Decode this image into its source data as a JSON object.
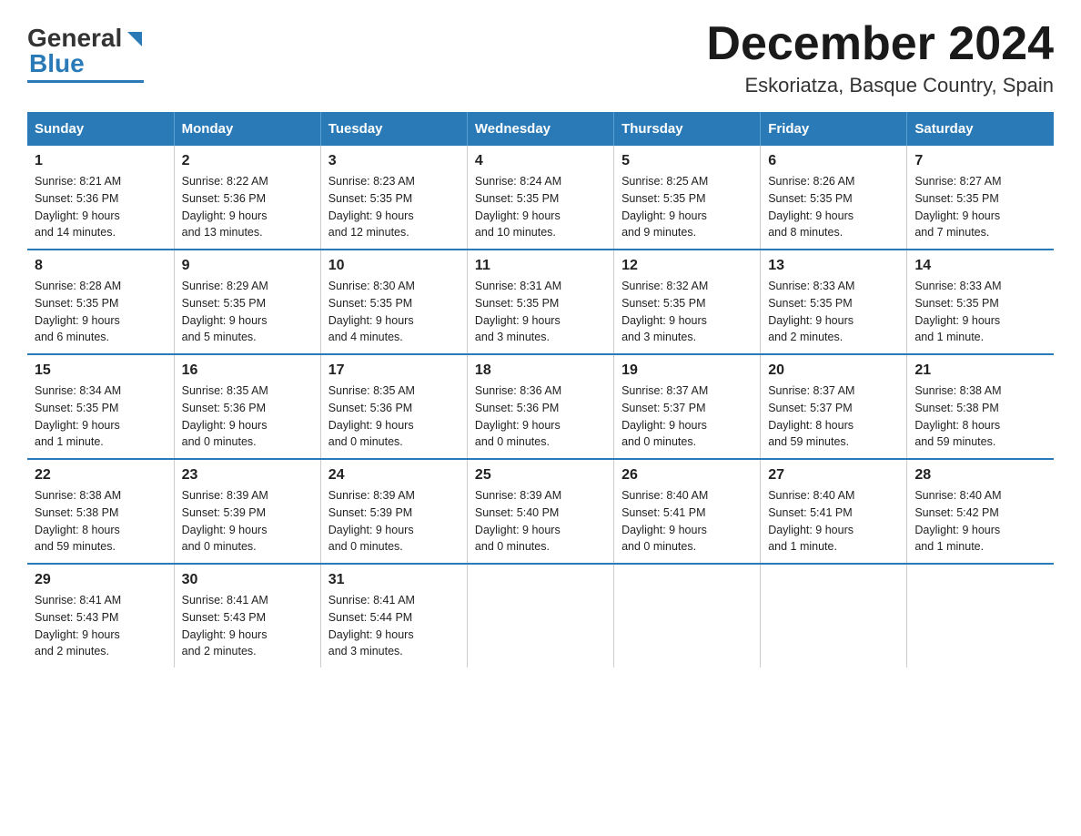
{
  "header": {
    "title": "December 2024",
    "subtitle": "Eskoriatza, Basque Country, Spain",
    "logo_general": "General",
    "logo_blue": "Blue"
  },
  "days_of_week": [
    "Sunday",
    "Monday",
    "Tuesday",
    "Wednesday",
    "Thursday",
    "Friday",
    "Saturday"
  ],
  "weeks": [
    [
      {
        "date": "1",
        "info": "Sunrise: 8:21 AM\nSunset: 5:36 PM\nDaylight: 9 hours\nand 14 minutes."
      },
      {
        "date": "2",
        "info": "Sunrise: 8:22 AM\nSunset: 5:36 PM\nDaylight: 9 hours\nand 13 minutes."
      },
      {
        "date": "3",
        "info": "Sunrise: 8:23 AM\nSunset: 5:35 PM\nDaylight: 9 hours\nand 12 minutes."
      },
      {
        "date": "4",
        "info": "Sunrise: 8:24 AM\nSunset: 5:35 PM\nDaylight: 9 hours\nand 10 minutes."
      },
      {
        "date": "5",
        "info": "Sunrise: 8:25 AM\nSunset: 5:35 PM\nDaylight: 9 hours\nand 9 minutes."
      },
      {
        "date": "6",
        "info": "Sunrise: 8:26 AM\nSunset: 5:35 PM\nDaylight: 9 hours\nand 8 minutes."
      },
      {
        "date": "7",
        "info": "Sunrise: 8:27 AM\nSunset: 5:35 PM\nDaylight: 9 hours\nand 7 minutes."
      }
    ],
    [
      {
        "date": "8",
        "info": "Sunrise: 8:28 AM\nSunset: 5:35 PM\nDaylight: 9 hours\nand 6 minutes."
      },
      {
        "date": "9",
        "info": "Sunrise: 8:29 AM\nSunset: 5:35 PM\nDaylight: 9 hours\nand 5 minutes."
      },
      {
        "date": "10",
        "info": "Sunrise: 8:30 AM\nSunset: 5:35 PM\nDaylight: 9 hours\nand 4 minutes."
      },
      {
        "date": "11",
        "info": "Sunrise: 8:31 AM\nSunset: 5:35 PM\nDaylight: 9 hours\nand 3 minutes."
      },
      {
        "date": "12",
        "info": "Sunrise: 8:32 AM\nSunset: 5:35 PM\nDaylight: 9 hours\nand 3 minutes."
      },
      {
        "date": "13",
        "info": "Sunrise: 8:33 AM\nSunset: 5:35 PM\nDaylight: 9 hours\nand 2 minutes."
      },
      {
        "date": "14",
        "info": "Sunrise: 8:33 AM\nSunset: 5:35 PM\nDaylight: 9 hours\nand 1 minute."
      }
    ],
    [
      {
        "date": "15",
        "info": "Sunrise: 8:34 AM\nSunset: 5:35 PM\nDaylight: 9 hours\nand 1 minute."
      },
      {
        "date": "16",
        "info": "Sunrise: 8:35 AM\nSunset: 5:36 PM\nDaylight: 9 hours\nand 0 minutes."
      },
      {
        "date": "17",
        "info": "Sunrise: 8:35 AM\nSunset: 5:36 PM\nDaylight: 9 hours\nand 0 minutes."
      },
      {
        "date": "18",
        "info": "Sunrise: 8:36 AM\nSunset: 5:36 PM\nDaylight: 9 hours\nand 0 minutes."
      },
      {
        "date": "19",
        "info": "Sunrise: 8:37 AM\nSunset: 5:37 PM\nDaylight: 9 hours\nand 0 minutes."
      },
      {
        "date": "20",
        "info": "Sunrise: 8:37 AM\nSunset: 5:37 PM\nDaylight: 8 hours\nand 59 minutes."
      },
      {
        "date": "21",
        "info": "Sunrise: 8:38 AM\nSunset: 5:38 PM\nDaylight: 8 hours\nand 59 minutes."
      }
    ],
    [
      {
        "date": "22",
        "info": "Sunrise: 8:38 AM\nSunset: 5:38 PM\nDaylight: 8 hours\nand 59 minutes."
      },
      {
        "date": "23",
        "info": "Sunrise: 8:39 AM\nSunset: 5:39 PM\nDaylight: 9 hours\nand 0 minutes."
      },
      {
        "date": "24",
        "info": "Sunrise: 8:39 AM\nSunset: 5:39 PM\nDaylight: 9 hours\nand 0 minutes."
      },
      {
        "date": "25",
        "info": "Sunrise: 8:39 AM\nSunset: 5:40 PM\nDaylight: 9 hours\nand 0 minutes."
      },
      {
        "date": "26",
        "info": "Sunrise: 8:40 AM\nSunset: 5:41 PM\nDaylight: 9 hours\nand 0 minutes."
      },
      {
        "date": "27",
        "info": "Sunrise: 8:40 AM\nSunset: 5:41 PM\nDaylight: 9 hours\nand 1 minute."
      },
      {
        "date": "28",
        "info": "Sunrise: 8:40 AM\nSunset: 5:42 PM\nDaylight: 9 hours\nand 1 minute."
      }
    ],
    [
      {
        "date": "29",
        "info": "Sunrise: 8:41 AM\nSunset: 5:43 PM\nDaylight: 9 hours\nand 2 minutes."
      },
      {
        "date": "30",
        "info": "Sunrise: 8:41 AM\nSunset: 5:43 PM\nDaylight: 9 hours\nand 2 minutes."
      },
      {
        "date": "31",
        "info": "Sunrise: 8:41 AM\nSunset: 5:44 PM\nDaylight: 9 hours\nand 3 minutes."
      },
      {
        "date": "",
        "info": ""
      },
      {
        "date": "",
        "info": ""
      },
      {
        "date": "",
        "info": ""
      },
      {
        "date": "",
        "info": ""
      }
    ]
  ]
}
